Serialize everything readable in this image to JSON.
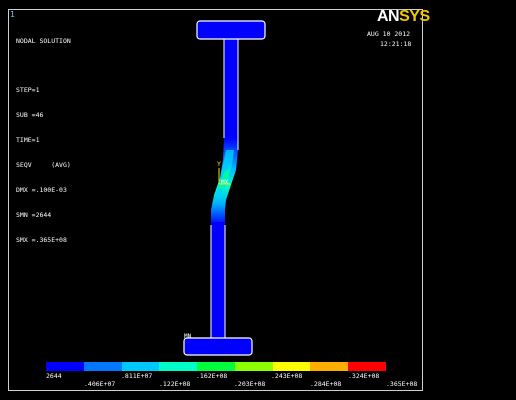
{
  "window_number": "1",
  "info_lines": [
    "NODAL SOLUTION",
    "",
    "STEP=1",
    "SUB =46",
    "TIME=1",
    "SEQV     (AVG)",
    "DMX =.100E-03",
    "SMN =2644",
    "SMX =.365E+08"
  ],
  "logo": {
    "an": "AN",
    "sys": "SYS"
  },
  "date": "AUG 10 2012",
  "time": "12:21:18",
  "markers": {
    "mn": "MN",
    "mx": "MX",
    "y": "Y"
  },
  "legend": {
    "colors": [
      "#0000ff",
      "#0077ff",
      "#00c8ff",
      "#00ffc8",
      "#00ff3c",
      "#8cff00",
      "#ffff00",
      "#ffae00",
      "#ff0000"
    ],
    "top_ticks": [
      "2644",
      ".811E+07",
      ".162E+08",
      ".243E+08",
      ".324E+08"
    ],
    "bottom_ticks": [
      ".406E+07",
      ".122E+08",
      ".203E+08",
      ".284E+08",
      ".365E+08"
    ]
  }
}
